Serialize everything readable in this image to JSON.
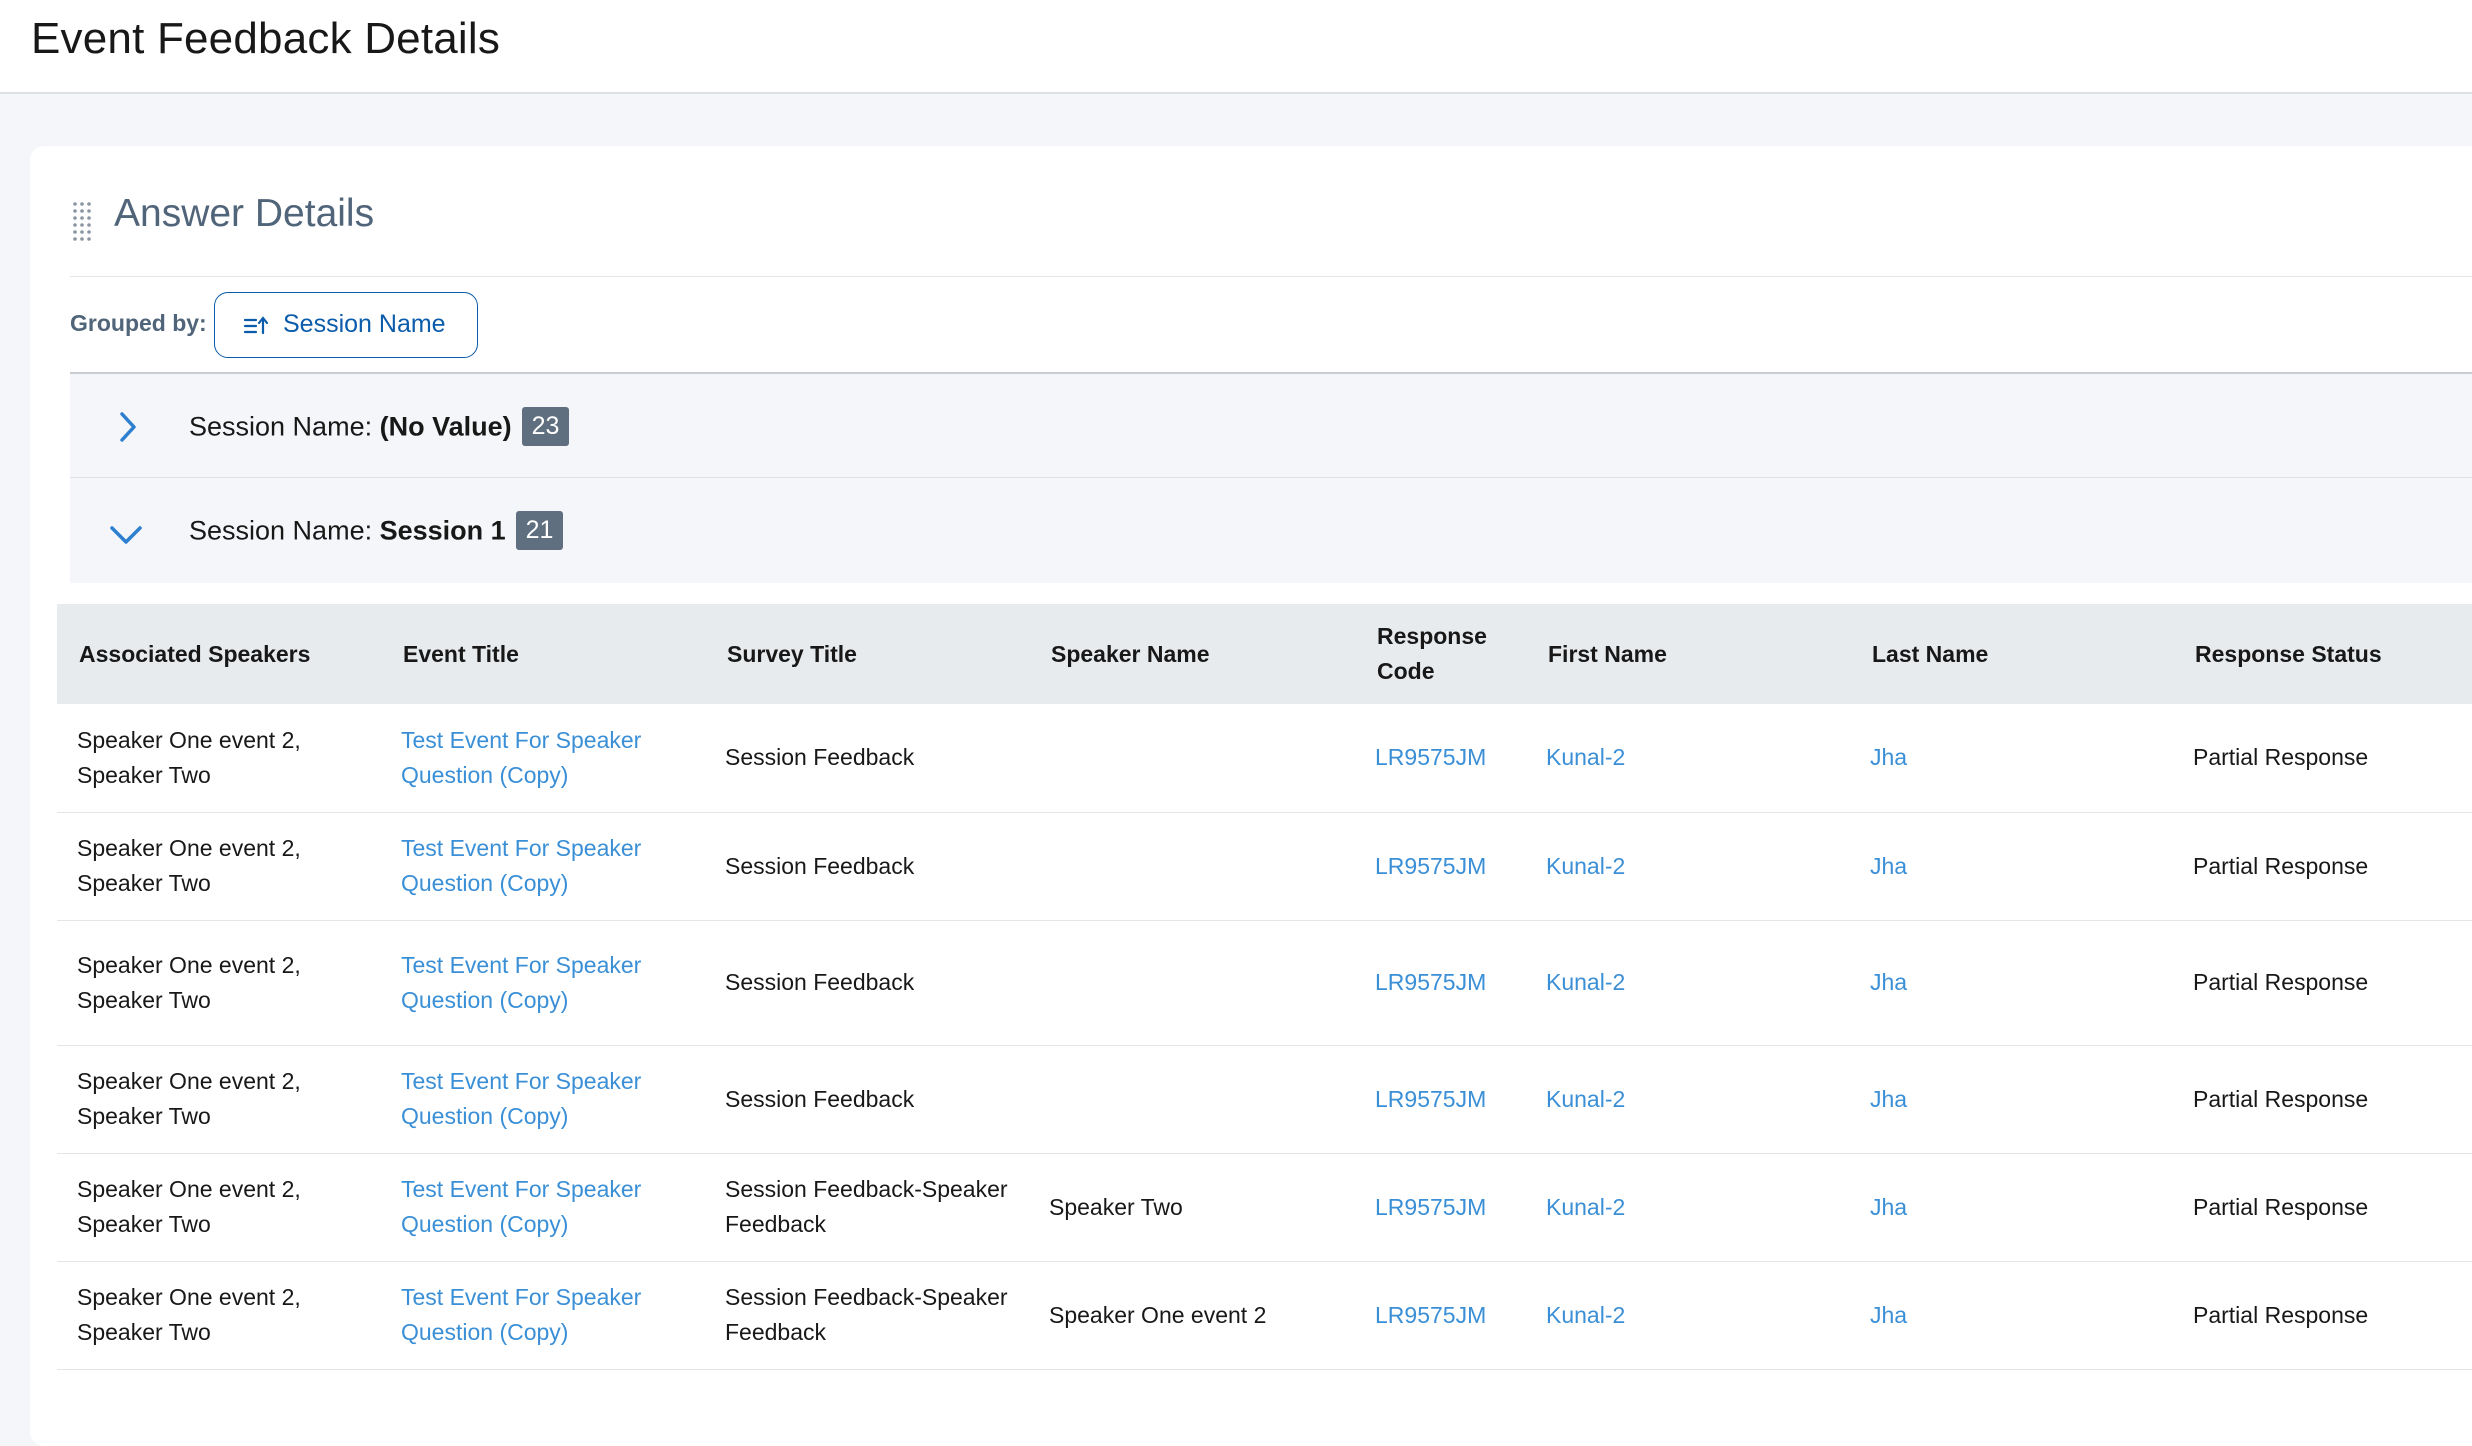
{
  "page": {
    "title": "Event Feedback Details"
  },
  "card": {
    "title": "Answer Details"
  },
  "grouping": {
    "label": "Grouped by:",
    "value": "Session Name"
  },
  "groups": [
    {
      "prefix": "Session Name: ",
      "value": "(No Value)",
      "count": "23",
      "expanded": false
    },
    {
      "prefix": "Session Name: ",
      "value": "Session 1",
      "count": "21",
      "expanded": true
    }
  ],
  "table": {
    "headers": [
      "Associated Speakers",
      "Event Title",
      "Survey Title",
      "Speaker Name",
      "Response Code",
      "First Name",
      "Last Name",
      "Response Status"
    ],
    "rows": [
      [
        "Speaker One event 2, Speaker Two",
        "Test Event For Speaker Question (Copy)",
        "Session Feedback",
        "",
        "LR9575JM",
        "Kunal-2",
        "Jha",
        "Partial Response"
      ],
      [
        "Speaker One event 2, Speaker Two",
        "Test Event For Speaker Question (Copy)",
        "Session Feedback",
        "",
        "LR9575JM",
        "Kunal-2",
        "Jha",
        "Partial Response"
      ],
      [
        "Speaker One event 2, Speaker Two",
        "Test Event For Speaker Question (Copy)",
        "Session Feedback",
        "",
        "LR9575JM",
        "Kunal-2",
        "Jha",
        "Partial Response"
      ],
      [
        "Speaker One event 2, Speaker Two",
        "Test Event For Speaker Question (Copy)",
        "Session Feedback",
        "",
        "LR9575JM",
        "Kunal-2",
        "Jha",
        "Partial Response"
      ],
      [
        "Speaker One event 2, Speaker Two",
        "Test Event For Speaker Question (Copy)",
        "Session Feedback-Speaker Feedback",
        "Speaker Two",
        "LR9575JM",
        "Kunal-2",
        "Jha",
        "Partial Response"
      ],
      [
        "Speaker One event 2, Speaker Two",
        "Test Event For Speaker Question (Copy)",
        "Session Feedback-Speaker Feedback",
        "Speaker One event 2",
        "LR9575JM",
        "Kunal-2",
        "Jha",
        "Partial Response"
      ]
    ]
  },
  "colors": {
    "link": "#3a8fd6",
    "brand": "#0b5cab",
    "badge": "#5f6f7f"
  },
  "icons": {
    "drag": "drag-handle-icon",
    "group": "sort-group-icon",
    "collapsed": "chevron-right-icon",
    "expanded": "chevron-down-icon"
  }
}
